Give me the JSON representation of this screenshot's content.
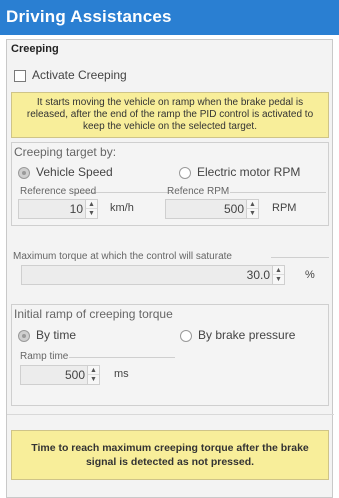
{
  "window": {
    "title": "Driving Assistances"
  },
  "creeping": {
    "section_title": "Creeping",
    "activate_label": "Activate Creeping",
    "activate_checked": false,
    "info_text": "It starts moving the vehicle on ramp when the brake pedal is released, after the end of the ramp the PID control is activated to keep the vehicle on the selected target.",
    "target": {
      "group_title": "Creeping target by:",
      "option_vehicle_speed": "Vehicle Speed",
      "option_motor_rpm": "Electric motor RPM",
      "selected": "Vehicle Speed",
      "reference_speed_label": "Reference speed",
      "reference_speed_value": "10",
      "reference_speed_unit": "km/h",
      "reference_rpm_label": "Refence RPM",
      "reference_rpm_value": "500",
      "reference_rpm_unit": "RPM"
    },
    "max_torque": {
      "label": "Maximum torque at which the control will saturate",
      "value": "30.0",
      "unit": "%"
    },
    "initial_ramp": {
      "group_title": "Initial ramp of creeping torque",
      "option_by_time": "By time",
      "option_by_brake_pressure": "By brake pressure",
      "selected": "By time",
      "ramp_time_label": "Ramp time",
      "ramp_time_value": "500",
      "ramp_time_unit": "ms"
    },
    "bottom_info_text": "Time to reach maximum creeping torque after the brake signal is detected as not pressed."
  },
  "colors": {
    "titlebar": "#2a7fd2",
    "info_background": "#f8ee9a"
  },
  "icons": {
    "spin_up": "spin-up-arrow-icon",
    "spin_down": "spin-down-arrow-icon"
  }
}
